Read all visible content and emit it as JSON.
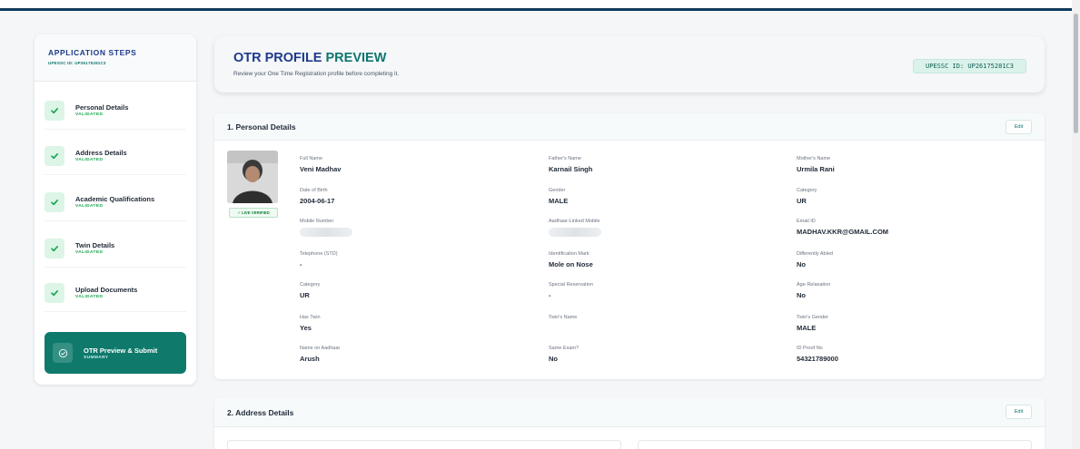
{
  "sidebar": {
    "title": "APPLICATION STEPS",
    "subtitle": "UPESSC ID: UP26175281C3",
    "steps": [
      {
        "label": "Personal Details",
        "status": "VALIDATED"
      },
      {
        "label": "Address Details",
        "status": "VALIDATED"
      },
      {
        "label": "Academic Qualifications",
        "status": "VALIDATED"
      },
      {
        "label": "Twin Details",
        "status": "VALIDATED"
      },
      {
        "label": "Upload Documents",
        "status": "VALIDATED"
      }
    ],
    "active": {
      "label": "OTR Preview & Submit",
      "status": "SUMMARY"
    }
  },
  "header": {
    "title_main": "OTR PROFILE",
    "title_accent": "PREVIEW",
    "description": "Review your One Time Registration profile before completing it.",
    "id_badge": "UPESSC ID: UP26175281C3"
  },
  "personal": {
    "title": "1. Personal Details",
    "edit_label": "Edit",
    "live_verified": "✓ LIVE VERIFIED",
    "full_name": {
      "label": "Full Name",
      "value": "Veni Madhav"
    },
    "father_name": {
      "label": "Father's Name",
      "value": "Karnail Singh"
    },
    "mother_name": {
      "label": "Mother's Name",
      "value": "Urmila Rani"
    },
    "dob": {
      "label": "Date of Birth",
      "value": "2004-06-17"
    },
    "gender": {
      "label": "Gender",
      "value": "MALE"
    },
    "category1": {
      "label": "Category",
      "value": "UR"
    },
    "mobile": {
      "label": "Mobile Number"
    },
    "aadhaar_mobile": {
      "label": "Aadhaar-Linked Mobile"
    },
    "email": {
      "label": "Email ID",
      "value": "MADHAV.KKR@GMAIL.COM"
    },
    "telephone": {
      "label": "Telephone (STD)",
      "value": "-"
    },
    "id_mark": {
      "label": "Identification Mark",
      "value": "Mole on Nose"
    },
    "diff_abled": {
      "label": "Differently Abled",
      "value": "No"
    },
    "category2": {
      "label": "Category",
      "value": "UR"
    },
    "special_res": {
      "label": "Special Reservation",
      "value": "-"
    },
    "age_relax": {
      "label": "Age Relaxation",
      "value": "No"
    },
    "has_twin": {
      "label": "Has Twin",
      "value": "Yes"
    },
    "twin_name": {
      "label": "Twin's Name",
      "value": ""
    },
    "twin_gender": {
      "label": "Twin's Gender",
      "value": "MALE"
    },
    "aadhaar_name": {
      "label": "Name on Aadhaar",
      "value": "Arush"
    },
    "same_exam": {
      "label": "Same Exam?",
      "value": "No"
    },
    "id_proof": {
      "label": "ID Proof No",
      "value": "54321789000"
    }
  },
  "address": {
    "title": "2. Address Details",
    "edit_label": "Edit"
  },
  "colors": {
    "primary_navy": "#1e3a8a",
    "accent_teal": "#0f766e",
    "active_step": "#0f7a6c",
    "validated_green": "#16a34a"
  }
}
